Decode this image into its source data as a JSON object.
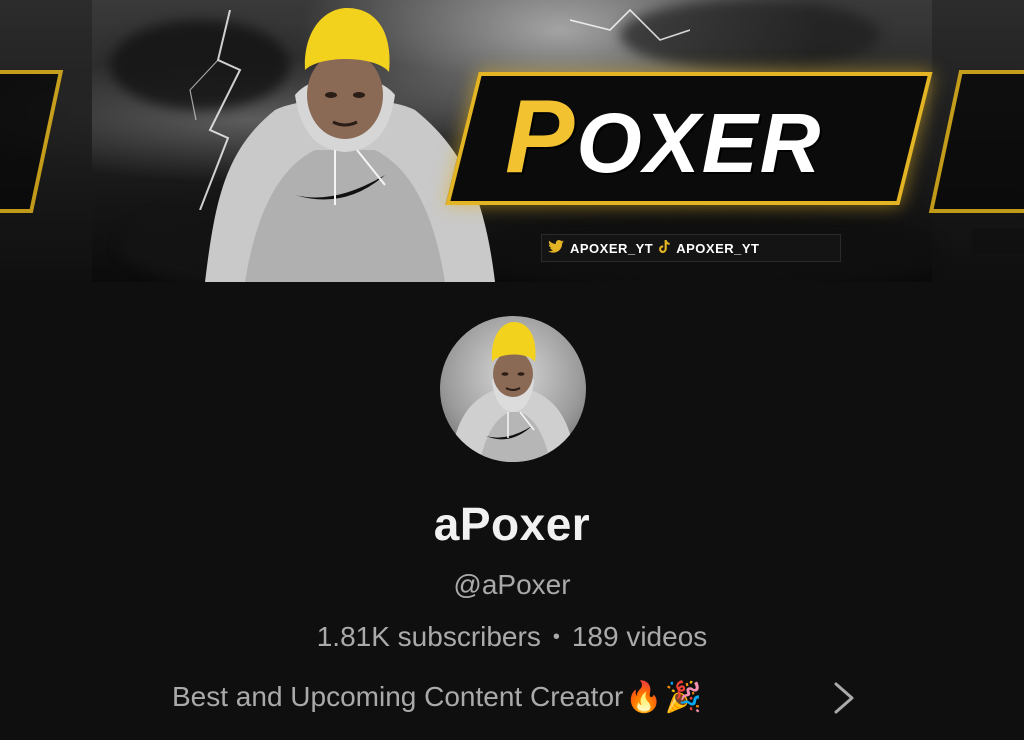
{
  "banner": {
    "logo_first_letter": "P",
    "logo_rest": "OXER",
    "twitter_handle": "APOXER_YT",
    "tiktok_handle": "APOXER_YT",
    "accent_color": "#e3b423"
  },
  "channel": {
    "name": "aPoxer",
    "handle": "@aPoxer",
    "subscribers": "1.81K subscribers",
    "separator": "•",
    "videos": "189 videos",
    "description": "Best and Upcoming Content Creator",
    "description_emojis": [
      "🔥",
      "🎉"
    ]
  },
  "icons": {
    "twitter": "twitter-icon",
    "tiktok": "tiktok-icon",
    "chevron": "chevron-right-icon"
  }
}
